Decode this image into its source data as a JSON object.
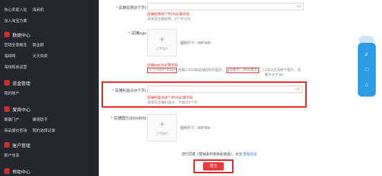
{
  "sidebar": {
    "top_items": [
      {
        "label": "核心卖家入驻"
      },
      {
        "label": "海商机"
      },
      {
        "label": "加入淘宝方案"
      }
    ],
    "sections": [
      {
        "title": "数据中心",
        "items": [
          [
            "营销全景概览",
            "黄金眼"
          ],
          [
            "海绵鸭",
            "天天特卖"
          ],
          [
            "海线和自运营"
          ]
        ]
      },
      {
        "title": "资金管理",
        "items": [
          [
            "我的账户"
          ]
        ]
      },
      {
        "title": "聚商中心",
        "items": [
          [
            "聚赢门户",
            "聚组助手"
          ],
          [
            "商品报价查询",
            "我的选择记录"
          ]
        ]
      },
      {
        "title": "账户管理",
        "items": [
          [
            "账户信息"
          ]
        ]
      },
      {
        "title": "帮助中心",
        "items": []
      }
    ]
  },
  "form": {
    "store_name": {
      "label": "店铺名称(8个字):",
      "required": true,
      "counter": "0/8",
      "error": "店铺名称(8个字)为必填字段",
      "hint": "请填写店铺名称，8个字以内"
    },
    "store_logo": {
      "label": "店铺logo:",
      "required": true,
      "upload_text": "上传图片",
      "size_note": "图例尺寸：800*400",
      "error": "店铺logo为必填字段",
      "hint_part1": "尺寸为800*400px",
      "hint_part2": "店铺LOGO和店铺招标的图片，",
      "hint_part3": "jpg格式，PNG格式",
      "hint_part4": "，LOGO应清晰于图片，诱",
      "hint_line2": "量不大于3M"
    },
    "store_slogan": {
      "label": "店铺利益点(8个字):",
      "required": true,
      "counter": "0/8",
      "error": "店铺利益点(8个字)为必填字段",
      "hint": "请填写店铺利益点，不超过8个字"
    },
    "store_images": {
      "label": "店铺图片(800x800):",
      "required": true,
      "upload_text": "上传图片",
      "size_note": "图例尺寸：800*800"
    },
    "agreement": {
      "text": "您已同意《营销素材使用承诺函》，点击",
      "link": "查看协议"
    },
    "submit_label": "提交"
  },
  "float_toolbar": {
    "icons": [
      "bell-icon",
      "chat-icon",
      "home-icon"
    ]
  }
}
